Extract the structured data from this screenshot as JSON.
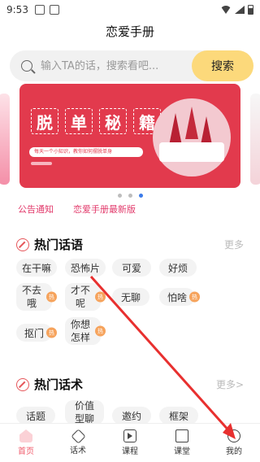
{
  "status_bar": {
    "time": "9:53"
  },
  "header": {
    "title": "恋爱手册"
  },
  "search": {
    "placeholder": "输入TA的话，搜索看吧...",
    "button_label": "搜索"
  },
  "banner": {
    "chars": [
      "脱",
      "单",
      "秘",
      "籍"
    ],
    "subtitle": "每天一个小知识，教你如何摆脱单身"
  },
  "links": {
    "notice": "公告通知",
    "latest": "恋爱手册最新版"
  },
  "hot_phrases": {
    "title": "热门话语",
    "more": "更多",
    "chips": [
      {
        "label": "在干嘛"
      },
      {
        "label": "恐怖片"
      },
      {
        "label": "可爱"
      },
      {
        "label": "好烦"
      },
      {
        "label": "不去哦",
        "hot": "热"
      },
      {
        "label": "才不呢",
        "hot": "热"
      },
      {
        "label": "无聊"
      },
      {
        "label": "怕啥",
        "hot": "热"
      },
      {
        "label": "抠门",
        "hot": "热"
      },
      {
        "label": "你想怎样",
        "hot": "热"
      }
    ]
  },
  "hot_tactics": {
    "title": "热门话术",
    "more": "更多>",
    "chips": [
      {
        "label": "话题"
      },
      {
        "label": "价值型聊"
      },
      {
        "label": "邀约"
      },
      {
        "label": "框架"
      }
    ]
  },
  "bottom_nav": {
    "items": [
      {
        "label": "首页",
        "icon": "home-icon"
      },
      {
        "label": "话术",
        "icon": "tag-icon"
      },
      {
        "label": "课程",
        "icon": "play-icon"
      },
      {
        "label": "课堂",
        "icon": "class-icon"
      },
      {
        "label": "我的",
        "icon": "user-icon"
      }
    ]
  },
  "colors": {
    "accent": "#f05a6a",
    "search_button": "#fcd97b",
    "banner": "#e23a4d",
    "link": "#e23a6b"
  }
}
